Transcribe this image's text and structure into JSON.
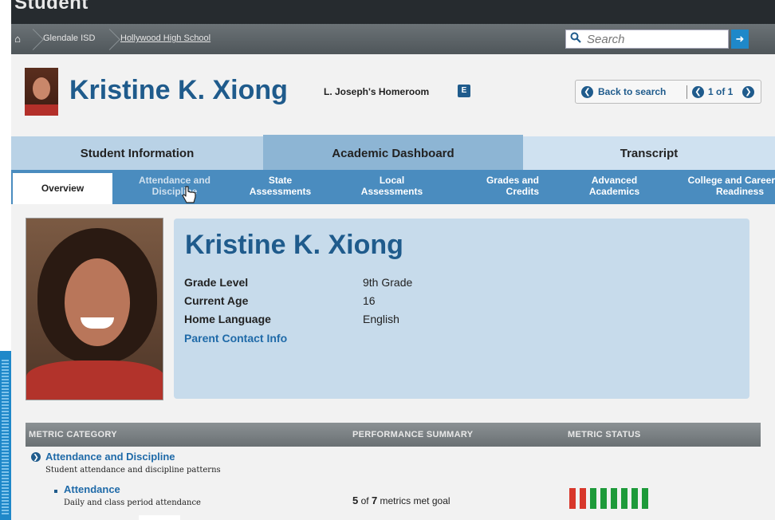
{
  "window": {
    "title": "Student"
  },
  "breadcrumb": {
    "items": [
      "Glendale ISD",
      "Hollywood High School"
    ]
  },
  "search": {
    "placeholder": "Search",
    "go_icon": "arrow-right-icon"
  },
  "student": {
    "name": "Kristine K. Xiong",
    "homeroom": "L. Joseph's Homeroom",
    "homeroom_badge": "E",
    "grade_level_label": "Grade Level",
    "grade_level": "9th Grade",
    "age_label": "Current Age",
    "age": "16",
    "language_label": "Home Language",
    "language": "English",
    "parent_link": "Parent Contact Info"
  },
  "navigation": {
    "back_label": "Back to search",
    "pager": "1 of 1"
  },
  "tabs": [
    "Student Information",
    "Academic Dashboard",
    "Transcript"
  ],
  "active_tab": "Academic Dashboard",
  "subtabs": [
    {
      "line1": "Overview",
      "line2": ""
    },
    {
      "line1": "Attendance and",
      "line2": "Discipline"
    },
    {
      "line1": "State",
      "line2": "Assessments"
    },
    {
      "line1": "Local",
      "line2": "Assessments"
    },
    {
      "line1": "Grades and",
      "line2": "Credits"
    },
    {
      "line1": "Advanced",
      "line2": "Academics"
    },
    {
      "line1": "College and Career",
      "line2": "Readiness"
    }
  ],
  "metrics": {
    "headers": [
      "METRIC CATEGORY",
      "PERFORMANCE SUMMARY",
      "METRIC STATUS"
    ],
    "category": {
      "title": "Attendance and Discipline",
      "description": "Student attendance and discipline patterns"
    },
    "item": {
      "title": "Attendance",
      "description": "Daily and class period attendance",
      "met": "5",
      "of": "of",
      "total": "7",
      "suffix": "metrics met goal",
      "status": [
        "red",
        "red",
        "green",
        "green",
        "green",
        "green",
        "green",
        "green"
      ]
    }
  },
  "colors": {
    "brand": "#1f5b8c",
    "status_red": "#d8372b",
    "status_green": "#1e9a3a"
  }
}
